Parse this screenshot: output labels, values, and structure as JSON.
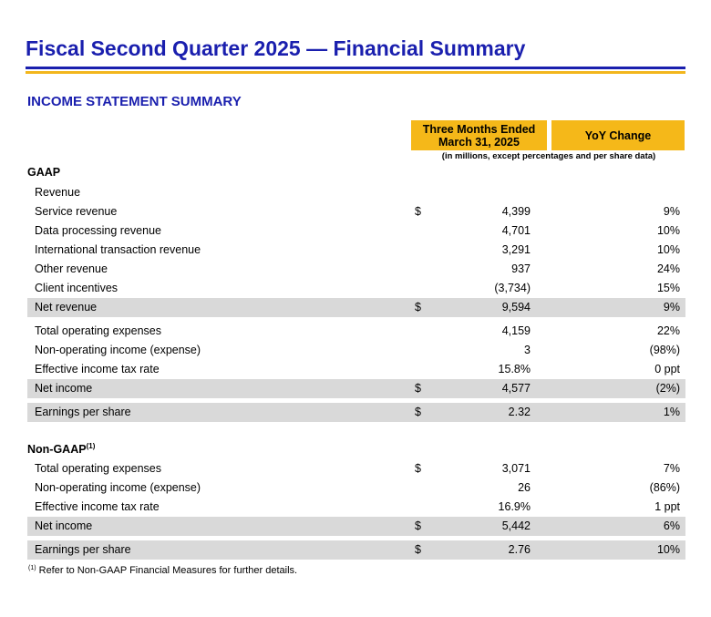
{
  "title": "Fiscal Second Quarter 2025 — Financial Summary",
  "section_title": "INCOME STATEMENT SUMMARY",
  "columns": {
    "period_line1": "Three Months Ended",
    "period_line2": "March 31, 2025",
    "yoy": "YoY Change",
    "units": "(in millions, except percentages and per share data)"
  },
  "gaap": {
    "heading": "GAAP",
    "subheading": "Revenue",
    "rows": [
      {
        "label": "Service revenue",
        "currency": "$",
        "value": "4,399",
        "yoy": "9%"
      },
      {
        "label": "Data processing revenue",
        "currency": "",
        "value": "4,701",
        "yoy": "10%"
      },
      {
        "label": "International transaction revenue",
        "currency": "",
        "value": "3,291",
        "yoy": "10%"
      },
      {
        "label": "Other revenue",
        "currency": "",
        "value": "937",
        "yoy": "24%"
      },
      {
        "label": "Client incentives",
        "currency": "",
        "value": "(3,734)",
        "yoy": "15%"
      },
      {
        "label": "Net revenue",
        "currency": "$",
        "value": "9,594",
        "yoy": "9%"
      },
      {
        "label": "Total operating expenses",
        "currency": "",
        "value": "4,159",
        "yoy": "22%"
      },
      {
        "label": "Non-operating income (expense)",
        "currency": "",
        "value": "3",
        "yoy": "(98%)"
      },
      {
        "label": "Effective income tax rate",
        "currency": "",
        "value": "15.8%",
        "yoy": "0 ppt"
      },
      {
        "label": "Net income",
        "currency": "$",
        "value": "4,577",
        "yoy": "(2%)"
      },
      {
        "label": "Earnings per share",
        "currency": "$",
        "value": "2.32",
        "yoy": "1%"
      }
    ]
  },
  "non_gaap": {
    "heading": "Non-GAAP",
    "heading_note": "(1)",
    "rows": [
      {
        "label": "Total operating expenses",
        "currency": "$",
        "value": "3,071",
        "yoy": "7%"
      },
      {
        "label": "Non-operating income (expense)",
        "currency": "",
        "value": "26",
        "yoy": "(86%)"
      },
      {
        "label": "Effective income tax rate",
        "currency": "",
        "value": "16.9%",
        "yoy": "1 ppt"
      },
      {
        "label": "Net income",
        "currency": "$",
        "value": "5,442",
        "yoy": "6%"
      },
      {
        "label": "Earnings per share",
        "currency": "$",
        "value": "2.76",
        "yoy": "10%"
      }
    ]
  },
  "footnote": {
    "mark": "(1)",
    "text": " Refer to Non-GAAP Financial Measures for further details."
  }
}
